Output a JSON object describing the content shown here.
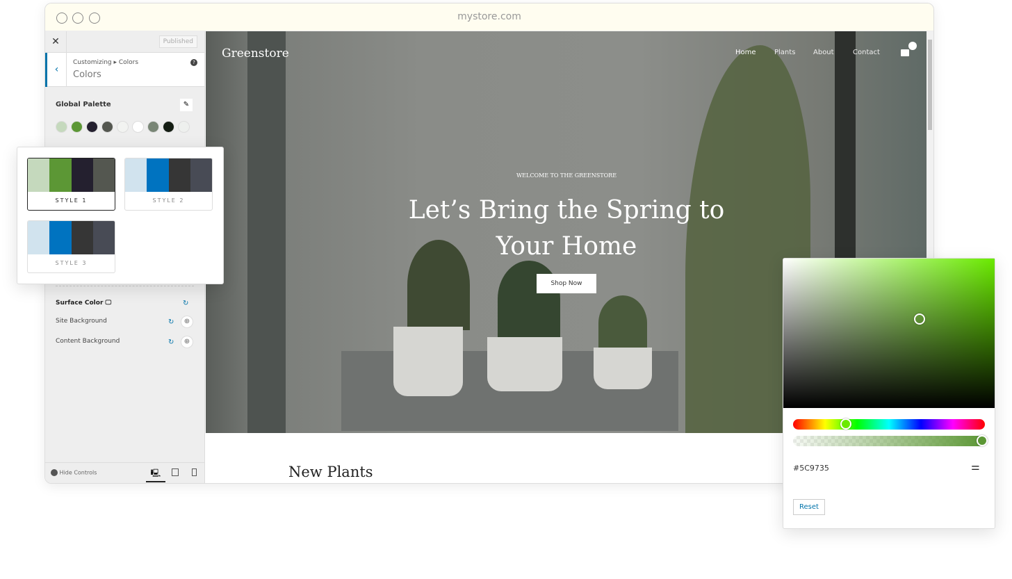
{
  "browser": {
    "url": "mystore.com"
  },
  "sidebar": {
    "close": "✕",
    "published": "Published",
    "breadcrumb": "Customizing ▸ Colors",
    "title": "Colors",
    "help": "?",
    "global_palette": "Global Palette",
    "palette_colors": [
      "#c5d9bd",
      "#5c9735",
      "#24202f",
      "#545750",
      "#f2f3f1",
      "#ffffff",
      "#798676",
      "#141d13",
      "#eef0ee"
    ],
    "surface_color": "Surface Color",
    "site_background": "Site Background",
    "content_background": "Content Background",
    "hide_controls": "Hide Controls"
  },
  "palette_popover": {
    "styles": [
      {
        "label": "STYLE 1",
        "colors": [
          "#c5d9bd",
          "#5c9735",
          "#24202f",
          "#545750"
        ],
        "selected": true
      },
      {
        "label": "STYLE 2",
        "colors": [
          "#d1e3ee",
          "#0073c0",
          "#363636",
          "#484b55"
        ],
        "selected": false
      },
      {
        "label": "STYLE 3",
        "colors": [
          "#d1e3ee",
          "#0073c0",
          "#363636",
          "#484b55"
        ],
        "selected": false
      }
    ]
  },
  "site": {
    "logo": "Greenstore",
    "nav": [
      "Home",
      "Plants",
      "About",
      "Contact"
    ],
    "welcome": "WELCOME TO THE GREENSTORE",
    "headline_1": "Let’s Bring the Spring to",
    "headline_2": "Your Home",
    "cta": "Shop Now",
    "section_title": "New Plants"
  },
  "color_picker": {
    "hex": "#5C9735",
    "reset": "Reset",
    "alpha": 1.0
  }
}
